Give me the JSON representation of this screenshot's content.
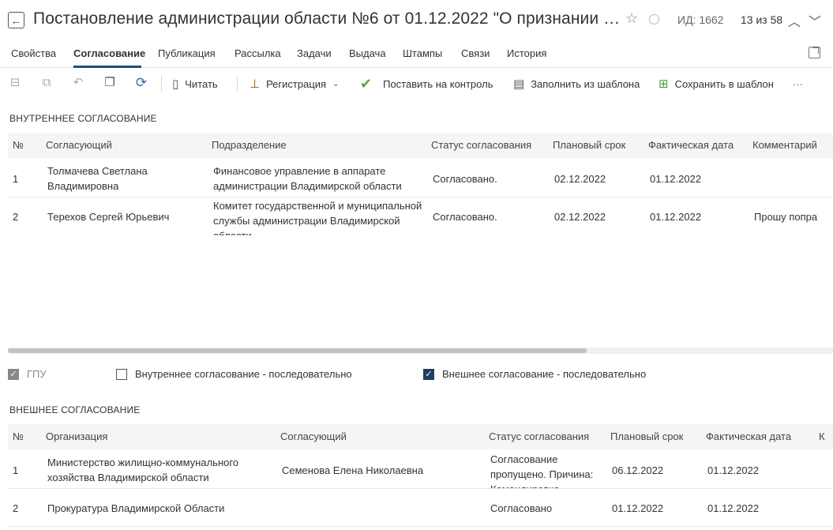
{
  "header": {
    "title": "Постановление администрации области №6 от 01.12.2022 \"О признании утрат...",
    "id_label": "ИД: 1662",
    "pager": "13 из 58"
  },
  "tabs": [
    {
      "label": "Свойства",
      "active": false
    },
    {
      "label": "Согласование",
      "active": true
    },
    {
      "label": "Публикация",
      "active": false
    },
    {
      "label": "Рассылка",
      "active": false
    },
    {
      "label": "Задачи",
      "active": false
    },
    {
      "label": "Выдача",
      "active": false
    },
    {
      "label": "Штампы",
      "active": false
    },
    {
      "label": "Связи",
      "active": false
    },
    {
      "label": "История",
      "active": false
    }
  ],
  "toolbar": {
    "read": "Читать",
    "registration": "Регистрация",
    "control": "Поставить на контроль",
    "fill_template": "Заполнить из шаблона",
    "save_template": "Сохранить в шаблон",
    "more": "···"
  },
  "internal": {
    "title": "ВНУТРЕННЕЕ СОГЛАСОВАНИЕ",
    "columns": [
      "№",
      "Согласующий",
      "Подразделение",
      "Статус согласования",
      "Плановый срок",
      "Фактическая дата",
      "Комментарий"
    ],
    "rows": [
      {
        "num": "1",
        "person": "Толмачева Светлана Владимировна",
        "dept": "Финансовое управление в аппарате администрации Владимирской области",
        "status": "Согласовано.",
        "plan": "02.12.2022",
        "fact": "01.12.2022",
        "comment": ""
      },
      {
        "num": "2",
        "person": "Терехов Сергей Юрьевич",
        "dept": "Комитет государственной и муниципальной службы администрации Владимирской области",
        "status": "Согласовано.",
        "plan": "02.12.2022",
        "fact": "01.12.2022",
        "comment": "Прошу попра"
      }
    ]
  },
  "checks": {
    "gpu": {
      "label": "ГПУ",
      "checked": true
    },
    "internal_seq": {
      "label": "Внутреннее согласование - последовательно",
      "checked": false
    },
    "external_seq": {
      "label": "Внешнее согласование - последовательно",
      "checked": true
    }
  },
  "external": {
    "title": "ВНЕШНЕЕ СОГЛАСОВАНИЕ",
    "columns": [
      "№",
      "Организация",
      "Согласующий",
      "Статус согласования",
      "Плановый срок",
      "Фактическая дата",
      "К"
    ],
    "rows": [
      {
        "num": "1",
        "org": "Министерство жилищно-коммунального хозяйства Владимирской области",
        "person": "Семенова Елена Николаевна",
        "status": "Согласование пропущено. Причина: Командировка",
        "plan": "06.12.2022",
        "fact": "01.12.2022"
      },
      {
        "num": "2",
        "org": "Прокуратура Владимирской Области",
        "person": "",
        "status": "Согласовано",
        "plan": "01.12.2022",
        "fact": "01.12.2022"
      }
    ]
  }
}
